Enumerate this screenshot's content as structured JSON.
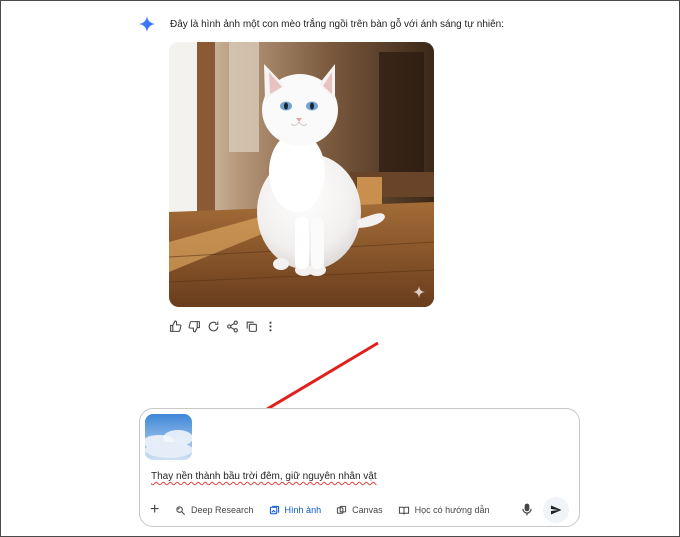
{
  "response": {
    "text": "Đây là hình ảnh một con mèo trắng ngồi trên bàn gỗ với ánh sáng tự nhiên:",
    "image_icon": "sparkle-icon",
    "actions": [
      "thumbs-up-icon",
      "thumbs-down-icon",
      "regenerate-icon",
      "share-icon",
      "copy-icon",
      "more-vert-icon"
    ]
  },
  "input": {
    "attachment": "sky-thumbnail",
    "prompt": "Thay nền thành bầu trời đêm, giữ nguyên nhân vật"
  },
  "toolbar": {
    "add_icon": "plus-icon",
    "deep_research": "Deep Research",
    "image": "Hình ảnh",
    "canvas": "Canvas",
    "guided_learning": "Học có hướng dẫn"
  },
  "colors": {
    "accent": "#0b57d0",
    "annotation_arrow": "#e0201c",
    "gemini_icon": "#3b82f6"
  }
}
